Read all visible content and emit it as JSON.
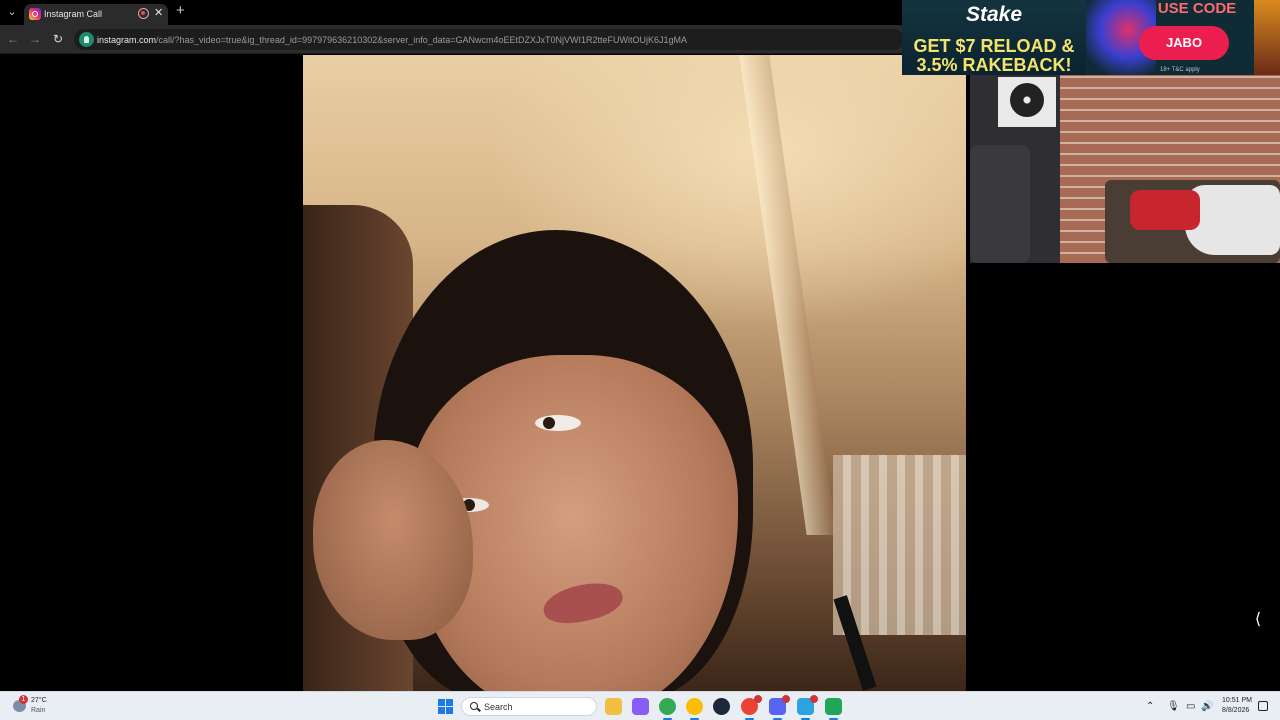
{
  "browser": {
    "tab": {
      "title": "Instagram Call"
    },
    "address": {
      "host": "instagram.com",
      "path": "/call/?has_video=true&ig_thread_id=997979636210302&server_info_data=GANwcm4oEEtDZXJxT0NjVWI1R2tteFUWitOUjK6J1gMA"
    }
  },
  "ad": {
    "logo": "Stake",
    "headline": "GET $7 RELOAD & 3.5% RAKEBACK!",
    "use_code": "USE CODE",
    "code": "JABO",
    "terms": "18+ T&C apply"
  },
  "taskbar": {
    "weather": {
      "badge": "1",
      "temp": "27°C",
      "condition": "Rain"
    },
    "search_placeholder": "Search",
    "clock": {
      "time": "10:51 PM",
      "date": "8/8/2026"
    },
    "apps": [
      {
        "name": "file-explorer-icon",
        "color": "#f0c040"
      },
      {
        "name": "copilot-icon",
        "color": "#8a5cf6"
      },
      {
        "name": "chrome-icon",
        "color": "#34a853"
      },
      {
        "name": "chrome-profile-icon",
        "color": "#fbbc05"
      },
      {
        "name": "steam-icon",
        "color": "#1b2838"
      },
      {
        "name": "chrome-dev-icon",
        "color": "#ea4335"
      },
      {
        "name": "discord-icon",
        "color": "#5865f2"
      },
      {
        "name": "telegram-icon",
        "color": "#2aa3df"
      },
      {
        "name": "app-icon",
        "color": "#1fa65a"
      }
    ]
  },
  "colors": {
    "tab_bg": "#2b2b2b",
    "toolbar_bg": "#2b2b2b",
    "taskbar_bg": "#e9eef5",
    "ad_accent": "#ec1d4f",
    "ad_headline": "#f4e36b"
  }
}
